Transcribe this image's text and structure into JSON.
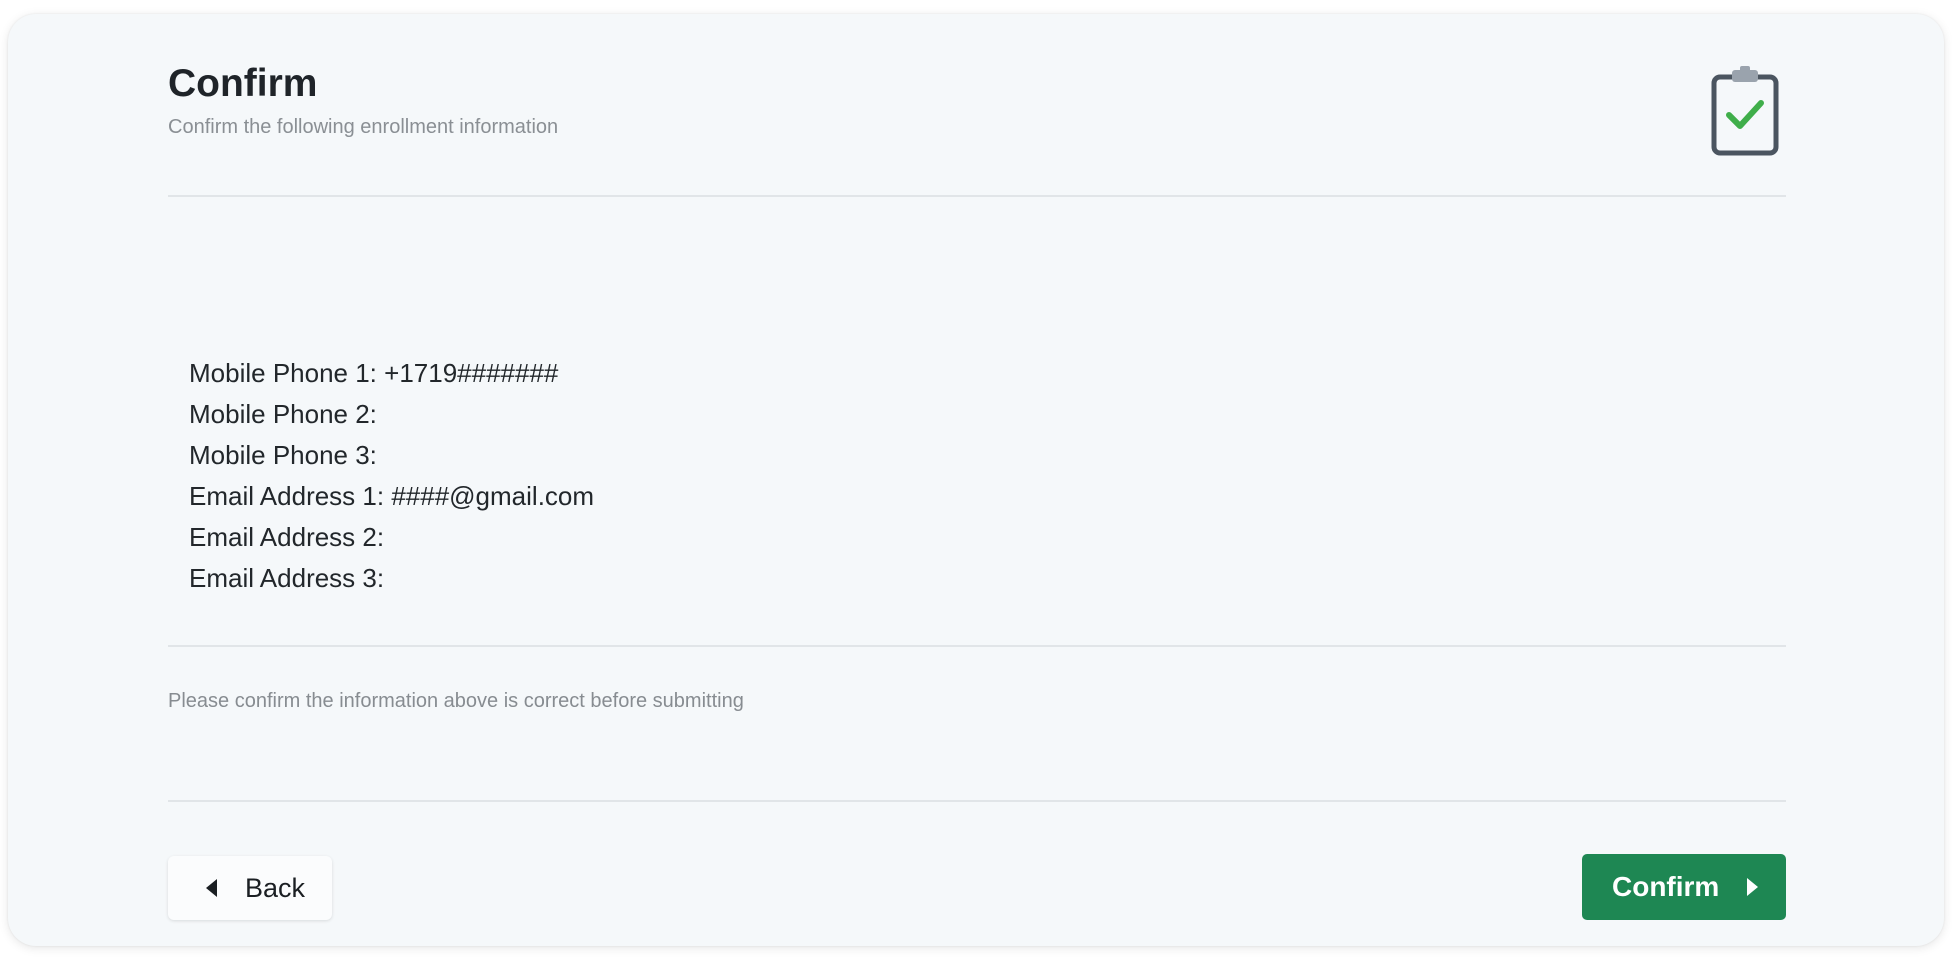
{
  "header": {
    "title": "Confirm",
    "subtitle": "Confirm the following enrollment information",
    "icon": "clipboard-check-icon"
  },
  "enrollment": {
    "rows": [
      {
        "label": "Mobile Phone 1:",
        "value": "+1719#######"
      },
      {
        "label": "Mobile Phone 2:",
        "value": ""
      },
      {
        "label": "Mobile Phone 3:",
        "value": ""
      },
      {
        "label": "Email Address 1:",
        "value": "####@gmail.com"
      },
      {
        "label": "Email Address 2:",
        "value": ""
      },
      {
        "label": "Email Address 3:",
        "value": ""
      }
    ]
  },
  "note": "Please confirm the information above is correct before submitting",
  "actions": {
    "back_label": "Back",
    "back_icon": "caret-left-icon",
    "confirm_label": "Confirm",
    "confirm_icon": "caret-right-icon"
  },
  "colors": {
    "primary": "#1e8753",
    "check": "#3fae4a",
    "clipboard_outline": "#4b5560",
    "card_background": "#f5f8fa"
  }
}
